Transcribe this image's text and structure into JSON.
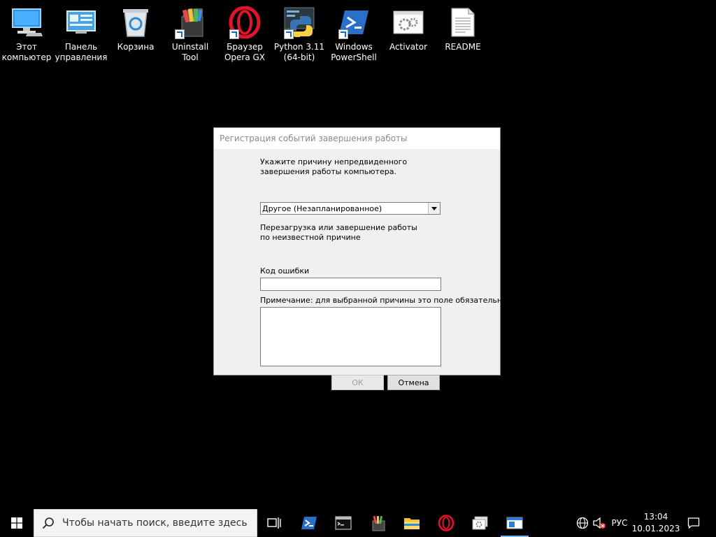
{
  "desktop": {
    "icons": [
      {
        "label": "Этот\nкомпьютер",
        "icon": "this-pc-icon"
      },
      {
        "label": "Панель\nуправления",
        "icon": "control-panel-icon"
      },
      {
        "label": "Корзина",
        "icon": "recycle-bin-icon"
      },
      {
        "label": "Uninstall Tool",
        "icon": "uninstall-tool-icon"
      },
      {
        "label": "Браузер\nOpera GX",
        "icon": "opera-gx-icon"
      },
      {
        "label": "Python 3.11\n(64-bit)",
        "icon": "python-icon"
      },
      {
        "label": "Windows\nPowerShell",
        "icon": "powershell-icon"
      },
      {
        "label": "Activator",
        "icon": "activator-icon"
      },
      {
        "label": "README",
        "icon": "document-icon"
      }
    ]
  },
  "dialog": {
    "title": "Регистрация событий завершения работы",
    "prompt": "Укажите причину непредвиденного завершения работы компьютера.",
    "reason_selected": "Другое (Незапланированное)",
    "reason_description": "Перезагрузка или завершение работы по неизвестной причине",
    "error_code_label": "Код ошибки",
    "error_code_value": "",
    "note_label": "Примечание: для выбранной причины это поле обязательно",
    "note_value": "",
    "ok_label": "ОК",
    "cancel_label": "Отмена"
  },
  "taskbar": {
    "search_placeholder": "Чтобы начать поиск, введите здесь",
    "language": "РУС",
    "time": "13:04",
    "date": "10.01.2023",
    "accent": "#76b9ed"
  }
}
